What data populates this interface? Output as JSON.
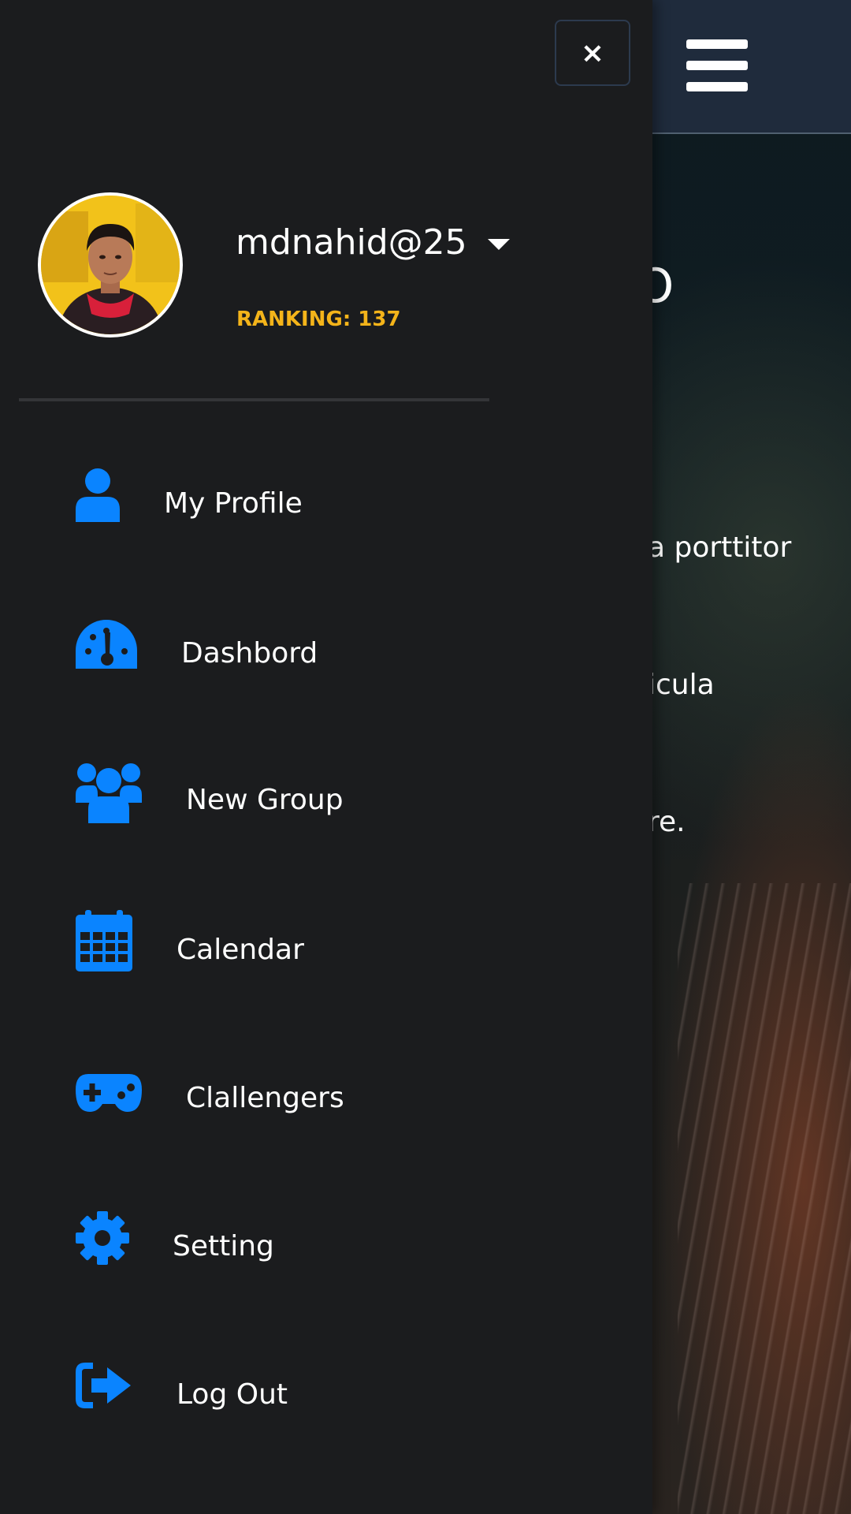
{
  "app": {
    "accent_color": "#0a84ff",
    "drawer_bg": "#1b1c1e",
    "rank_color": "#f4b41a"
  },
  "drawer": {
    "close_label": "×",
    "profile": {
      "username": "mdnahid@25",
      "ranking": "RANKING: 137",
      "avatar_icon": "user-avatar-photo"
    },
    "menu": [
      {
        "label": "My Profile",
        "icon": "user-icon"
      },
      {
        "label": "Dashbord",
        "icon": "speedometer-icon"
      },
      {
        "label": "New Group",
        "icon": "users-group-icon"
      },
      {
        "label": "Calendar",
        "icon": "calendar-icon"
      },
      {
        "label": "Clallengers",
        "icon": "gamepad-icon"
      },
      {
        "label": "Setting",
        "icon": "gear-icon"
      },
      {
        "label": "Log Out",
        "icon": "sign-out-icon"
      }
    ]
  },
  "background": {
    "heading_fragment": "O",
    "lines": [
      "a porttitor",
      "icula",
      "re."
    ],
    "menu_icon": "hamburger-icon"
  }
}
